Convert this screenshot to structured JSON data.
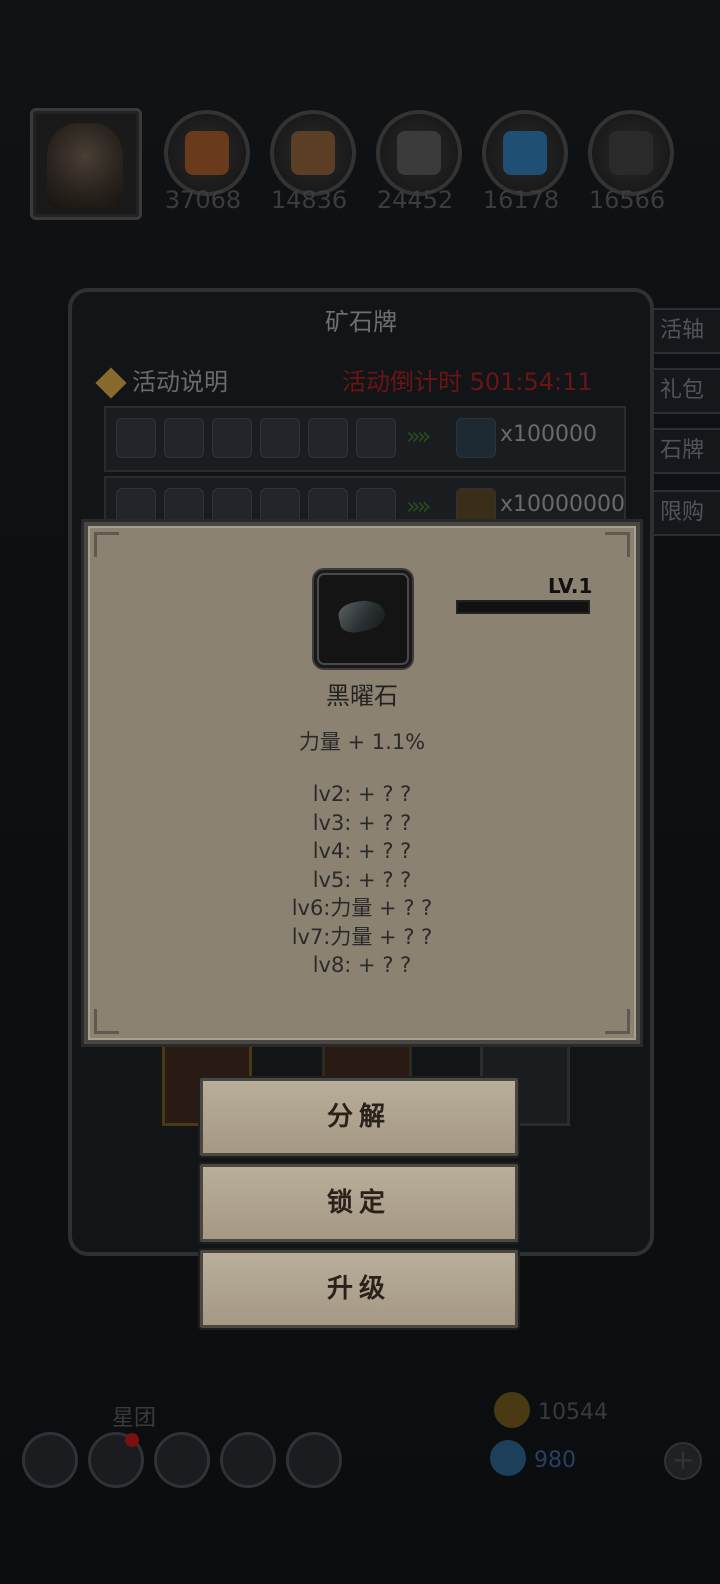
{
  "resources": {
    "values": [
      "37068",
      "14836",
      "24452",
      "16178",
      "16566"
    ],
    "colors": [
      "#6a3a1c",
      "#5a3e26",
      "#3b3b3b",
      "#1f4f73",
      "#2a2a2a"
    ]
  },
  "side_tabs": [
    "活轴",
    "礼包",
    "石牌",
    "限购"
  ],
  "ore_panel": {
    "title": "矿石牌",
    "info_label": "活动说明",
    "countdown": "活动倒计时 501:54:11",
    "rows": [
      {
        "arrows": "»»",
        "qty": "x100000"
      },
      {
        "arrows": "»»",
        "qty": "x10000000"
      }
    ]
  },
  "popup": {
    "level": "LV.1",
    "level_progress": 0.0,
    "item_name": "黑曜石",
    "effect": "力量 + 1.1%",
    "levels": [
      "lv2: + ? ?",
      "lv3: + ? ?",
      "lv4: + ? ?",
      "lv5: + ? ?",
      "lv6:力量 + ? ?",
      "lv7:力量 + ? ?",
      "lv8: + ? ?"
    ]
  },
  "actions": {
    "decompose": "分解",
    "lock": "锁定",
    "upgrade": "升级"
  },
  "bottom": {
    "guild_label": "星团",
    "gold": "10544",
    "gems": "980",
    "plus": "+"
  }
}
